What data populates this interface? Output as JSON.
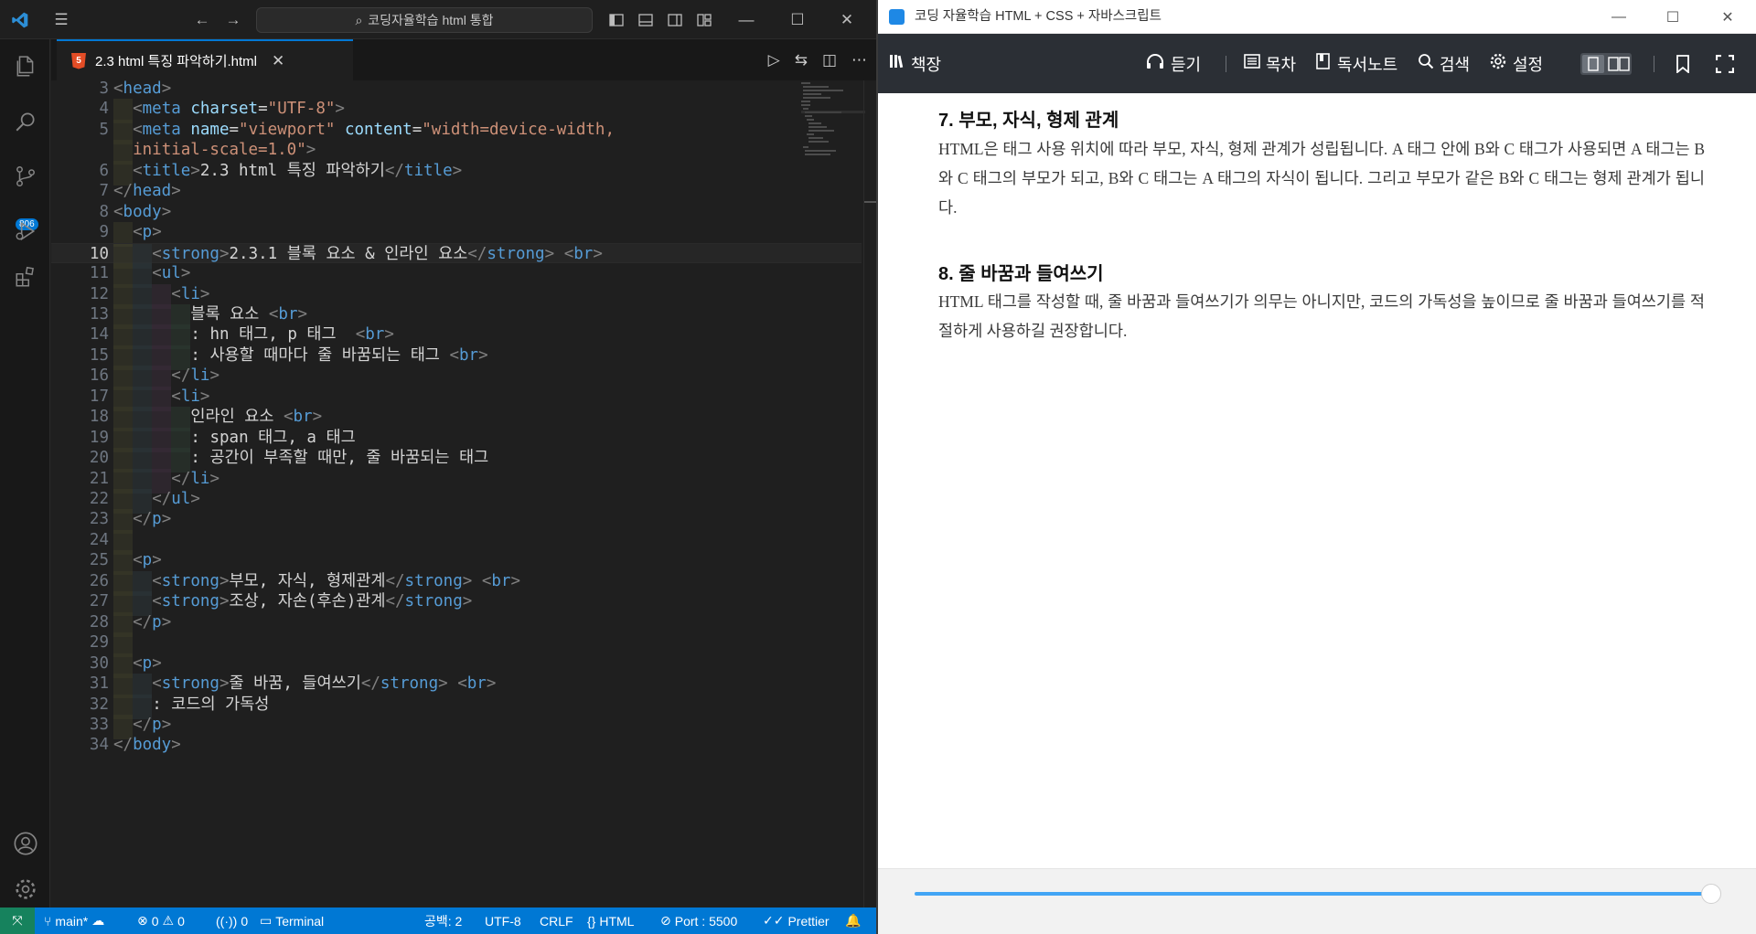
{
  "vscode": {
    "search_text": "코딩자율학습 html 통합",
    "tab": {
      "filename": "2.3 html 특징 파악하기.html"
    },
    "activity_badge": "806",
    "lines": [
      {
        "num": "3",
        "indent": 0,
        "parts": [
          [
            "t",
            "<"
          ],
          [
            "n",
            "head"
          ],
          [
            "t",
            ">"
          ]
        ]
      },
      {
        "num": "4",
        "indent": 1,
        "parts": [
          [
            "t",
            "<"
          ],
          [
            "n",
            "meta"
          ],
          [
            "txt",
            " "
          ],
          [
            "a",
            "charset"
          ],
          [
            "txt",
            "="
          ],
          [
            "s",
            "\"UTF-8\""
          ],
          [
            "t",
            ">"
          ]
        ]
      },
      {
        "num": "5",
        "indent": 1,
        "parts": [
          [
            "t",
            "<"
          ],
          [
            "n",
            "meta"
          ],
          [
            "txt",
            " "
          ],
          [
            "a",
            "name"
          ],
          [
            "txt",
            "="
          ],
          [
            "s",
            "\"viewport\""
          ],
          [
            "txt",
            " "
          ],
          [
            "a",
            "content"
          ],
          [
            "txt",
            "="
          ],
          [
            "s",
            "\"width=device-width,"
          ]
        ]
      },
      {
        "num": "",
        "indent": 1,
        "parts": [
          [
            "s",
            "initial-scale=1.0\""
          ],
          [
            "t",
            ">"
          ]
        ]
      },
      {
        "num": "6",
        "indent": 1,
        "parts": [
          [
            "t",
            "<"
          ],
          [
            "n",
            "title"
          ],
          [
            "t",
            ">"
          ],
          [
            "txt",
            "2.3 html 특징 파악하기"
          ],
          [
            "t",
            "</"
          ],
          [
            "n",
            "title"
          ],
          [
            "t",
            ">"
          ]
        ]
      },
      {
        "num": "7",
        "indent": 0,
        "parts": [
          [
            "t",
            "</"
          ],
          [
            "n",
            "head"
          ],
          [
            "t",
            ">"
          ]
        ]
      },
      {
        "num": "8",
        "indent": 0,
        "parts": [
          [
            "t",
            "<"
          ],
          [
            "n",
            "body"
          ],
          [
            "t",
            ">"
          ]
        ]
      },
      {
        "num": "9",
        "indent": 1,
        "parts": [
          [
            "t",
            "<"
          ],
          [
            "n",
            "p"
          ],
          [
            "t",
            ">"
          ]
        ]
      },
      {
        "num": "10",
        "indent": 2,
        "cur": true,
        "parts": [
          [
            "t",
            "<"
          ],
          [
            "n",
            "strong"
          ],
          [
            "t",
            ">"
          ],
          [
            "txt",
            "2.3.1 블록 요소 & 인라인 요소"
          ],
          [
            "t",
            "</"
          ],
          [
            "n",
            "strong"
          ],
          [
            "t",
            ">"
          ],
          [
            "txt",
            " "
          ],
          [
            "t",
            "<"
          ],
          [
            "n",
            "br"
          ],
          [
            "t",
            ">"
          ]
        ]
      },
      {
        "num": "11",
        "indent": 2,
        "parts": [
          [
            "t",
            "<"
          ],
          [
            "n",
            "ul"
          ],
          [
            "t",
            ">"
          ]
        ]
      },
      {
        "num": "12",
        "indent": 3,
        "parts": [
          [
            "t",
            "<"
          ],
          [
            "n",
            "li"
          ],
          [
            "t",
            ">"
          ]
        ]
      },
      {
        "num": "13",
        "indent": 4,
        "parts": [
          [
            "txt",
            "블록 요소 "
          ],
          [
            "t",
            "<"
          ],
          [
            "n",
            "br"
          ],
          [
            "t",
            ">"
          ]
        ]
      },
      {
        "num": "14",
        "indent": 4,
        "parts": [
          [
            "txt",
            ": hn 태그, p 태그  "
          ],
          [
            "t",
            "<"
          ],
          [
            "n",
            "br"
          ],
          [
            "t",
            ">"
          ]
        ]
      },
      {
        "num": "15",
        "indent": 4,
        "parts": [
          [
            "txt",
            ": 사용할 때마다 줄 바꿈되는 태그 "
          ],
          [
            "t",
            "<"
          ],
          [
            "n",
            "br"
          ],
          [
            "t",
            ">"
          ]
        ]
      },
      {
        "num": "16",
        "indent": 3,
        "parts": [
          [
            "t",
            "</"
          ],
          [
            "n",
            "li"
          ],
          [
            "t",
            ">"
          ]
        ]
      },
      {
        "num": "17",
        "indent": 3,
        "parts": [
          [
            "t",
            "<"
          ],
          [
            "n",
            "li"
          ],
          [
            "t",
            ">"
          ]
        ]
      },
      {
        "num": "18",
        "indent": 4,
        "parts": [
          [
            "txt",
            "인라인 요소 "
          ],
          [
            "t",
            "<"
          ],
          [
            "n",
            "br"
          ],
          [
            "t",
            ">"
          ]
        ]
      },
      {
        "num": "19",
        "indent": 4,
        "parts": [
          [
            "txt",
            ": span 태그, a 태그"
          ]
        ]
      },
      {
        "num": "20",
        "indent": 4,
        "parts": [
          [
            "txt",
            ": 공간이 부족할 때만, 줄 바꿈되는 태그"
          ]
        ]
      },
      {
        "num": "21",
        "indent": 3,
        "parts": [
          [
            "t",
            "</"
          ],
          [
            "n",
            "li"
          ],
          [
            "t",
            ">"
          ]
        ]
      },
      {
        "num": "22",
        "indent": 2,
        "parts": [
          [
            "t",
            "</"
          ],
          [
            "n",
            "ul"
          ],
          [
            "t",
            ">"
          ]
        ]
      },
      {
        "num": "23",
        "indent": 1,
        "parts": [
          [
            "t",
            "</"
          ],
          [
            "n",
            "p"
          ],
          [
            "t",
            ">"
          ]
        ]
      },
      {
        "num": "24",
        "indent": 1,
        "parts": []
      },
      {
        "num": "25",
        "indent": 1,
        "parts": [
          [
            "t",
            "<"
          ],
          [
            "n",
            "p"
          ],
          [
            "t",
            ">"
          ]
        ]
      },
      {
        "num": "26",
        "indent": 2,
        "parts": [
          [
            "t",
            "<"
          ],
          [
            "n",
            "strong"
          ],
          [
            "t",
            ">"
          ],
          [
            "txt",
            "부모, 자식, 형제관계"
          ],
          [
            "t",
            "</"
          ],
          [
            "n",
            "strong"
          ],
          [
            "t",
            ">"
          ],
          [
            "txt",
            " "
          ],
          [
            "t",
            "<"
          ],
          [
            "n",
            "br"
          ],
          [
            "t",
            ">"
          ]
        ]
      },
      {
        "num": "27",
        "indent": 2,
        "parts": [
          [
            "t",
            "<"
          ],
          [
            "n",
            "strong"
          ],
          [
            "t",
            ">"
          ],
          [
            "txt",
            "조상, 자손(후손)관계"
          ],
          [
            "t",
            "</"
          ],
          [
            "n",
            "strong"
          ],
          [
            "t",
            ">"
          ]
        ]
      },
      {
        "num": "28",
        "indent": 1,
        "parts": [
          [
            "t",
            "</"
          ],
          [
            "n",
            "p"
          ],
          [
            "t",
            ">"
          ]
        ]
      },
      {
        "num": "29",
        "indent": 1,
        "parts": []
      },
      {
        "num": "30",
        "indent": 1,
        "parts": [
          [
            "t",
            "<"
          ],
          [
            "n",
            "p"
          ],
          [
            "t",
            ">"
          ]
        ]
      },
      {
        "num": "31",
        "indent": 2,
        "parts": [
          [
            "t",
            "<"
          ],
          [
            "n",
            "strong"
          ],
          [
            "t",
            ">"
          ],
          [
            "txt",
            "줄 바꿈, 들여쓰기"
          ],
          [
            "t",
            "</"
          ],
          [
            "n",
            "strong"
          ],
          [
            "t",
            ">"
          ],
          [
            "txt",
            " "
          ],
          [
            "t",
            "<"
          ],
          [
            "n",
            "br"
          ],
          [
            "t",
            ">"
          ]
        ]
      },
      {
        "num": "32",
        "indent": 2,
        "parts": [
          [
            "txt",
            ": 코드의 가독성"
          ]
        ]
      },
      {
        "num": "33",
        "indent": 1,
        "parts": [
          [
            "t",
            "</"
          ],
          [
            "n",
            "p"
          ],
          [
            "t",
            ">"
          ]
        ]
      },
      {
        "num": "34",
        "indent": 0,
        "parts": [
          [
            "t",
            "</"
          ],
          [
            "n",
            "body"
          ],
          [
            "t",
            ">"
          ]
        ]
      }
    ],
    "status": {
      "branch": "main*",
      "errors": "0",
      "warnings": "0",
      "ports": "0",
      "terminal": "Terminal",
      "spaces": "공백: 2",
      "encoding": "UTF-8",
      "eol": "CRLF",
      "language": "HTML",
      "port": "Port : 5500",
      "prettier": "Prettier"
    }
  },
  "reader": {
    "title": "코딩 자율학습 HTML + CSS + 자바스크립트",
    "toolbar": {
      "bookshelf": "책장",
      "listen": "듣기",
      "toc": "목차",
      "notes": "독서노트",
      "search": "검색",
      "settings": "설정"
    },
    "sections": [
      {
        "heading": "7. 부모, 자식, 형제 관계",
        "body": "HTML은 태그 사용 위치에 따라 부모, 자식, 형제 관계가 성립됩니다. A 태그 안에 B와 C 태그가 사용되면 A 태그는 B와 C 태그의 부모가 되고, B와 C 태그는 A 태그의 자식이 됩니다. 그리고 부모가 같은 B와 C 태그는 형제 관계가 됩니다."
      },
      {
        "heading": "8. 줄 바꿈과 들여쓰기",
        "body": "HTML 태그를 작성할 때, 줄 바꿈과 들여쓰기가 의무는 아니지만, 코드의 가독성을 높이므로 줄 바꿈과 들여쓰기를 적절하게 사용하길 권장합니다."
      }
    ],
    "reading_progress": 0.99
  },
  "colors": {
    "vscode_accent": "#0078d4",
    "reader_toolbar": "#2b2f35",
    "reader_slider": "#42a5f5"
  }
}
